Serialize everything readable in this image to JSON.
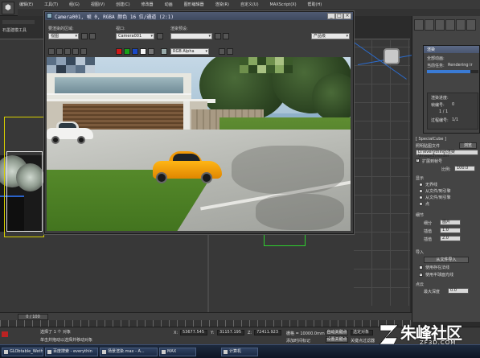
{
  "app": {
    "menu": [
      "编辑(E)",
      "工具(T)",
      "组(G)",
      "视图(V)",
      "创建(C)",
      "修改器",
      "动画",
      "图形编辑器",
      "渲染(R)",
      "自定义(U)",
      "MAXScript(X)",
      "帮助(H)"
    ],
    "tool_label": "石墨建模工具"
  },
  "render_window": {
    "title": "Camera001, 帧 0, RGBA 颜色 16 位/通道 (2:1)",
    "area_label": "要渲染的区域:",
    "area_value": "视图",
    "viewport_label": "视口:",
    "viewport_value": "Camera001",
    "preset_label": "渲染预设:",
    "preset_value": "",
    "product_value": "产品级",
    "channel_value": "RGB Alpha",
    "close_symbol": "×",
    "max_symbol": "□",
    "min_symbol": "_"
  },
  "progress_dialog": {
    "title": "渲染",
    "line1": "全部动画:",
    "line2_label": "当前任务:",
    "line2_value": "Rendering ir",
    "line3": "渲染进度:",
    "line4_label": "帧编号:",
    "line4_value": "0",
    "line5": "1 / 1",
    "line6_label": "过程编号:",
    "line6_value": "1/1",
    "progress": 0.85
  },
  "command_panel": {
    "item1": "[ SpecialCube ]",
    "section_file": "照明贴图文件",
    "browse": "浏览",
    "path_value": "D:\\everything\\渲染\\Image2\\render",
    "autosave": "扩展到帧号",
    "scale_label": "比例:",
    "scale_value": "100.0",
    "section_display": "显示",
    "radio1": "无界线",
    "radio2": "从文件/到引擎",
    "radio3": "从文件/到引擎",
    "radio4": "点",
    "section_detail": "细节",
    "field1_label": "细分",
    "field1_value": "图片",
    "field2_label": "插值",
    "field2_value": "1.0",
    "field3_label": "插值",
    "field3_value": "2.0",
    "section_import": "导入",
    "import_btn": "从文件导入",
    "check1": "使用存在法线",
    "check2": "使用半球面光线",
    "section_points": "点云",
    "points_label": "最大深度",
    "points_value": "0.0"
  },
  "timeline": {
    "slider": "0 / 100"
  },
  "status": {
    "line1": "选择了 1 个 对象",
    "line2": "单击并拖动以选择并移动对象",
    "x_label": "X:",
    "x_value": "53677.545",
    "y_label": "Y:",
    "y_value": "31157.195",
    "z_label": "Z:",
    "z_value": "72411.923",
    "grid": "栅格 = 10000.0mm",
    "auto_key": "自动关键点",
    "selected": "选定对象",
    "set_key": "设置关键点",
    "key_filter": "关键点过滤器",
    "add_tag": "添加时间标记"
  },
  "taskbar": {
    "items": [
      "GLObtable_Weth",
      "百度搜索 - everythin",
      "场景渲染.max - A...",
      "MAX",
      "计算机"
    ]
  },
  "watermark": {
    "cn": "朱峰社区",
    "en": "ZF3D.COM"
  },
  "colors": {
    "accent": "#2b6dd1",
    "yellow_frame": "#d8d000",
    "green_frame": "#2ed02e",
    "car_yellow": "#f5a300"
  }
}
